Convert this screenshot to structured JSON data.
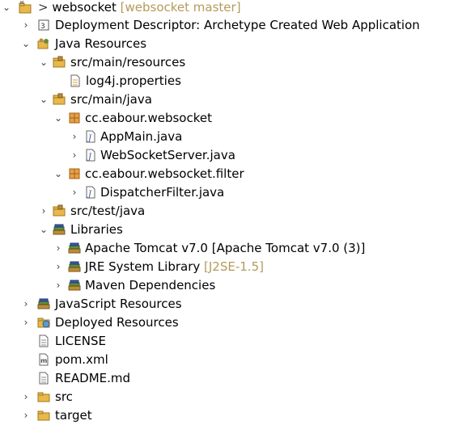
{
  "colors": {
    "decoration": "#b59a5a",
    "folder": "#e8b84a",
    "package": "#c08a3a",
    "library": "#6a8a3a"
  },
  "tree": {
    "project": {
      "label": "websocket",
      "prefix": ">",
      "decoration": "[websocket master]",
      "icon": "maven-project-icon"
    },
    "deployment_descriptor": {
      "label": "Deployment Descriptor: Archetype Created Web Application",
      "icon": "deployment-descriptor-icon"
    },
    "java_resources": {
      "label": "Java Resources",
      "icon": "java-resources-icon"
    },
    "src_main_resources": {
      "label": "src/main/resources",
      "icon": "source-folder-icon"
    },
    "log4j": {
      "label": "log4j.properties",
      "icon": "properties-file-icon"
    },
    "src_main_java": {
      "label": "src/main/java",
      "icon": "source-folder-icon"
    },
    "pkg_websocket": {
      "label": "cc.eabour.websocket",
      "icon": "package-icon"
    },
    "appmain": {
      "label": "AppMain.java",
      "icon": "java-file-icon"
    },
    "websocketserver": {
      "label": "WebSocketServer.java",
      "icon": "java-file-icon"
    },
    "pkg_filter": {
      "label": "cc.eabour.websocket.filter",
      "icon": "package-icon"
    },
    "dispatcherfilter": {
      "label": "DispatcherFilter.java",
      "icon": "java-file-icon"
    },
    "src_test_java": {
      "label": "src/test/java",
      "icon": "source-folder-icon"
    },
    "libraries": {
      "label": "Libraries",
      "icon": "library-icon"
    },
    "tomcat": {
      "label": "Apache Tomcat v7.0 [Apache Tomcat v7.0 (3)]",
      "icon": "library-icon"
    },
    "jre": {
      "label": "JRE System Library",
      "decoration": "[J2SE-1.5]",
      "icon": "library-icon"
    },
    "maven_deps": {
      "label": "Maven Dependencies",
      "icon": "library-icon"
    },
    "js_resources": {
      "label": "JavaScript Resources",
      "icon": "javascript-resources-icon"
    },
    "deployed_resources": {
      "label": "Deployed Resources",
      "icon": "deployed-resources-icon"
    },
    "license": {
      "label": "LICENSE",
      "icon": "text-file-icon"
    },
    "pom": {
      "label": "pom.xml",
      "icon": "xml-file-icon"
    },
    "readme": {
      "label": "README.md",
      "icon": "text-file-icon"
    },
    "src": {
      "label": "src",
      "icon": "folder-icon"
    },
    "target": {
      "label": "target",
      "icon": "folder-icon"
    }
  }
}
